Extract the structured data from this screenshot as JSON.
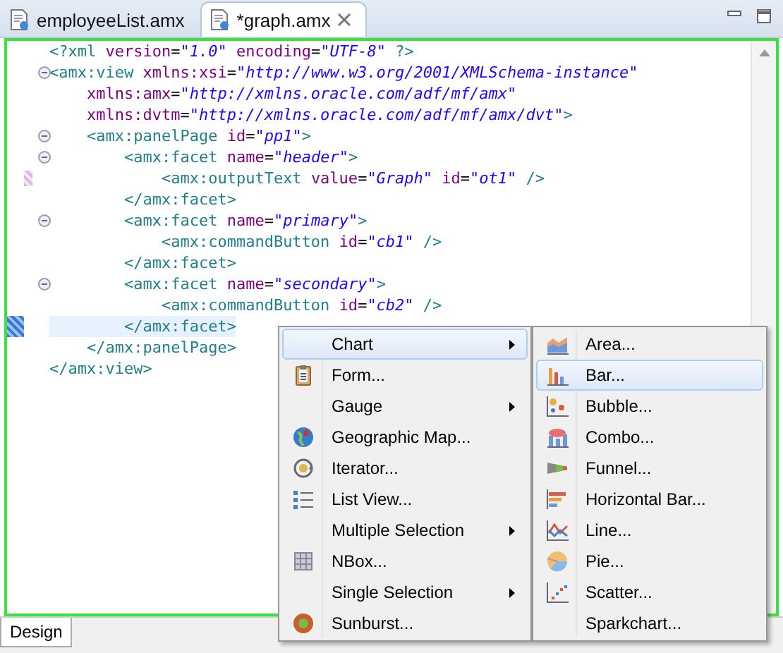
{
  "tabs": [
    {
      "label": "employeeList.amx",
      "selected": false
    },
    {
      "label": "*graph.amx",
      "selected": true
    }
  ],
  "code_lines": [
    {
      "fold": false,
      "current": false,
      "marker": false,
      "tokens": [
        {
          "kind": "tag",
          "text": "<?xml "
        },
        {
          "kind": "attr",
          "text": "version"
        },
        {
          "kind": "eq",
          "text": "="
        },
        {
          "kind": "value",
          "text": "\"1.0\""
        },
        {
          "kind": "attr",
          "text": " encoding"
        },
        {
          "kind": "eq",
          "text": "="
        },
        {
          "kind": "value",
          "text": "\"UTF-8\""
        },
        {
          "kind": "tag",
          "text": " ?>"
        }
      ]
    },
    {
      "fold": true,
      "current": false,
      "marker": false,
      "tokens": [
        {
          "kind": "tag",
          "text": "<amx:view "
        },
        {
          "kind": "attr",
          "text": "xmlns:xsi"
        },
        {
          "kind": "eq",
          "text": "="
        },
        {
          "kind": "value",
          "text": "\"http://www.w3.org/2001/XMLSchema-instance\""
        }
      ]
    },
    {
      "fold": false,
      "current": false,
      "marker": false,
      "tokens": [
        {
          "kind": "attr",
          "text": "    xmlns:amx"
        },
        {
          "kind": "eq",
          "text": "="
        },
        {
          "kind": "value",
          "text": "\"http://xmlns.oracle.com/adf/mf/amx\""
        }
      ]
    },
    {
      "fold": false,
      "current": false,
      "marker": false,
      "tokens": [
        {
          "kind": "attr",
          "text": "    xmlns:dvtm"
        },
        {
          "kind": "eq",
          "text": "="
        },
        {
          "kind": "value",
          "text": "\"http://xmlns.oracle.com/adf/mf/amx/dvt\""
        },
        {
          "kind": "tag",
          "text": ">"
        }
      ]
    },
    {
      "fold": true,
      "current": false,
      "marker": false,
      "tokens": [
        {
          "kind": "tag",
          "text": "    <amx:panelPage "
        },
        {
          "kind": "attr",
          "text": "id"
        },
        {
          "kind": "eq",
          "text": "="
        },
        {
          "kind": "value",
          "text": "\"pp1\""
        },
        {
          "kind": "tag",
          "text": ">"
        }
      ]
    },
    {
      "fold": true,
      "current": false,
      "marker": false,
      "tokens": [
        {
          "kind": "tag",
          "text": "        <amx:facet "
        },
        {
          "kind": "attr",
          "text": "name"
        },
        {
          "kind": "eq",
          "text": "="
        },
        {
          "kind": "value",
          "text": "\"header\""
        },
        {
          "kind": "tag",
          "text": ">"
        }
      ]
    },
    {
      "fold": false,
      "current": false,
      "marker": true,
      "tokens": [
        {
          "kind": "tag",
          "text": "            <amx:outputText "
        },
        {
          "kind": "attr",
          "text": "value"
        },
        {
          "kind": "eq",
          "text": "="
        },
        {
          "kind": "value",
          "text": "\"Graph\""
        },
        {
          "kind": "attr",
          "text": " id"
        },
        {
          "kind": "eq",
          "text": "="
        },
        {
          "kind": "value",
          "text": "\"ot1\""
        },
        {
          "kind": "tag",
          "text": " />"
        }
      ]
    },
    {
      "fold": false,
      "current": false,
      "marker": false,
      "tokens": [
        {
          "kind": "tag",
          "text": "        </amx:facet>"
        }
      ]
    },
    {
      "fold": true,
      "current": false,
      "marker": false,
      "tokens": [
        {
          "kind": "tag",
          "text": "        <amx:facet "
        },
        {
          "kind": "attr",
          "text": "name"
        },
        {
          "kind": "eq",
          "text": "="
        },
        {
          "kind": "value",
          "text": "\"primary\""
        },
        {
          "kind": "tag",
          "text": ">"
        }
      ]
    },
    {
      "fold": false,
      "current": false,
      "marker": false,
      "tokens": [
        {
          "kind": "tag",
          "text": "            <amx:commandButton "
        },
        {
          "kind": "attr",
          "text": "id"
        },
        {
          "kind": "eq",
          "text": "="
        },
        {
          "kind": "value",
          "text": "\"cb1\""
        },
        {
          "kind": "tag",
          "text": " />"
        }
      ]
    },
    {
      "fold": false,
      "current": false,
      "marker": false,
      "tokens": [
        {
          "kind": "tag",
          "text": "        </amx:facet>"
        }
      ]
    },
    {
      "fold": true,
      "current": false,
      "marker": false,
      "tokens": [
        {
          "kind": "tag",
          "text": "        <amx:facet "
        },
        {
          "kind": "attr",
          "text": "name"
        },
        {
          "kind": "eq",
          "text": "="
        },
        {
          "kind": "value",
          "text": "\"secondary\""
        },
        {
          "kind": "tag",
          "text": ">"
        }
      ]
    },
    {
      "fold": false,
      "current": false,
      "marker": false,
      "tokens": [
        {
          "kind": "tag",
          "text": "            <amx:commandButton "
        },
        {
          "kind": "attr",
          "text": "id"
        },
        {
          "kind": "eq",
          "text": "="
        },
        {
          "kind": "value",
          "text": "\"cb2\""
        },
        {
          "kind": "tag",
          "text": " />"
        }
      ]
    },
    {
      "fold": false,
      "current": true,
      "marker": false,
      "tokens": [
        {
          "kind": "tag",
          "text": "        </amx:facet>"
        }
      ]
    },
    {
      "fold": false,
      "current": false,
      "marker": false,
      "tokens": [
        {
          "kind": "tag",
          "text": "    </amx:panelPage>"
        }
      ]
    },
    {
      "fold": false,
      "current": false,
      "marker": false,
      "tokens": [
        {
          "kind": "tag",
          "text": "</amx:view>"
        }
      ]
    }
  ],
  "bottom_tabs": [
    {
      "label": "Design",
      "selected": true
    }
  ],
  "context_menu": [
    {
      "label": "Chart",
      "submenu": true,
      "selected": true
    },
    {
      "label": "Form...",
      "submenu": false,
      "selected": false
    },
    {
      "label": "Gauge",
      "submenu": true,
      "selected": false
    },
    {
      "label": "Geographic Map...",
      "submenu": false,
      "selected": false
    },
    {
      "label": "Iterator...",
      "submenu": false,
      "selected": false
    },
    {
      "label": "List View...",
      "submenu": false,
      "selected": false
    },
    {
      "label": "Multiple Selection",
      "submenu": true,
      "selected": false
    },
    {
      "label": "NBox...",
      "submenu": false,
      "selected": false
    },
    {
      "label": "Single Selection",
      "submenu": true,
      "selected": false
    },
    {
      "label": "Sunburst...",
      "submenu": false,
      "selected": false
    }
  ],
  "chart_submenu": [
    {
      "label": "Area...",
      "selected": false
    },
    {
      "label": "Bar...",
      "selected": true
    },
    {
      "label": "Bubble...",
      "selected": false
    },
    {
      "label": "Combo...",
      "selected": false
    },
    {
      "label": "Funnel...",
      "selected": false
    },
    {
      "label": "Horizontal Bar...",
      "selected": false
    },
    {
      "label": "Line...",
      "selected": false
    },
    {
      "label": "Pie...",
      "selected": false
    },
    {
      "label": "Scatter...",
      "selected": false
    },
    {
      "label": "Sparkchart...",
      "selected": false
    }
  ]
}
